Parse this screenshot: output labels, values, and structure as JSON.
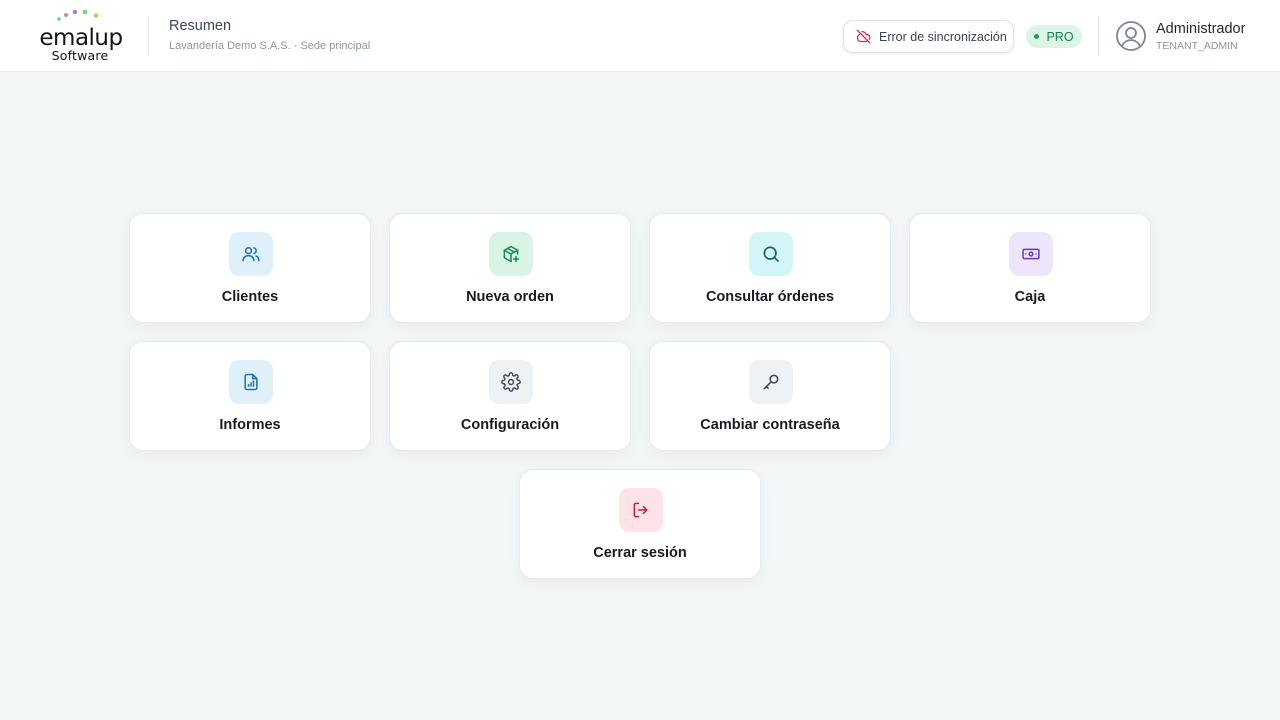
{
  "brand": {
    "name": "emalup",
    "sub": "Software"
  },
  "header": {
    "title": "Resumen",
    "subtitle": "Lavandería Demo S.A.S. · Sede principal",
    "sync_status": "Error de sincronización",
    "plan_badge": "PRO"
  },
  "user": {
    "name": "Administrador",
    "role": "TENANT_ADMIN"
  },
  "colors": {
    "blue_bg": "#e0f0fb",
    "blue_fg": "#1d6fa5",
    "green_bg": "#d9f4e5",
    "green_fg": "#168a4c",
    "cyan_bg": "#d4f5f7",
    "cyan_fg": "#0f7f8a",
    "purple_bg": "#ede6fb",
    "purple_fg": "#6d35c9",
    "gray_bg": "#eef1f5",
    "gray_fg": "#3a4352",
    "red_bg": "#fde3e6",
    "red_fg": "#d2284a"
  },
  "tiles": [
    {
      "label": "Clientes",
      "icon": "users-icon"
    },
    {
      "label": "Nueva orden",
      "icon": "package-plus-icon"
    },
    {
      "label": "Consultar órdenes",
      "icon": "search-icon"
    },
    {
      "label": "Caja",
      "icon": "banknote-icon"
    },
    {
      "label": "Informes",
      "icon": "report-icon"
    },
    {
      "label": "Configuración",
      "icon": "gear-icon"
    },
    {
      "label": "Cambiar contraseña",
      "icon": "key-icon"
    },
    {
      "label": "Cerrar sesión",
      "icon": "logout-icon"
    }
  ]
}
